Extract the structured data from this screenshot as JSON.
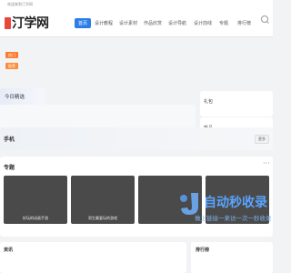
{
  "topbar": {
    "text": "欢迎来到汀学网"
  },
  "header": {
    "logo_text": "汀学网",
    "nav": [
      "首页",
      "设计教程",
      "设计素材",
      "作品欣赏",
      "设计导航",
      "设计前线",
      "专题",
      "排行榜"
    ],
    "active_index": 0
  },
  "tags": {
    "tag1": "热门",
    "tag2": "推荐"
  },
  "today": {
    "title": "今日精选"
  },
  "sidebar": {
    "box1_title": "礼包",
    "box2_title": "新品"
  },
  "phone_section": {
    "title": "手机",
    "more": "更多"
  },
  "topics": {
    "title": "专题",
    "more": "···",
    "cards": [
      {
        "corner": "",
        "caption": "好玩的动画手游"
      },
      {
        "corner": "",
        "caption": "男生最爱玩的游戏"
      },
      {
        "corner": "",
        "caption": ""
      },
      {
        "corner": "",
        "caption": ""
      }
    ]
  },
  "bottom": {
    "left_title": "资讯",
    "right_title": "排行榜"
  },
  "watermark": {
    "main": "自动秒收录",
    "sub": "做上链接一来访一次一秒收录"
  },
  "colors": {
    "accent": "#2b7de9",
    "logo_red": "#e8483c",
    "tag1": "#ff7a2f",
    "tag2": "#ff8c3a"
  }
}
